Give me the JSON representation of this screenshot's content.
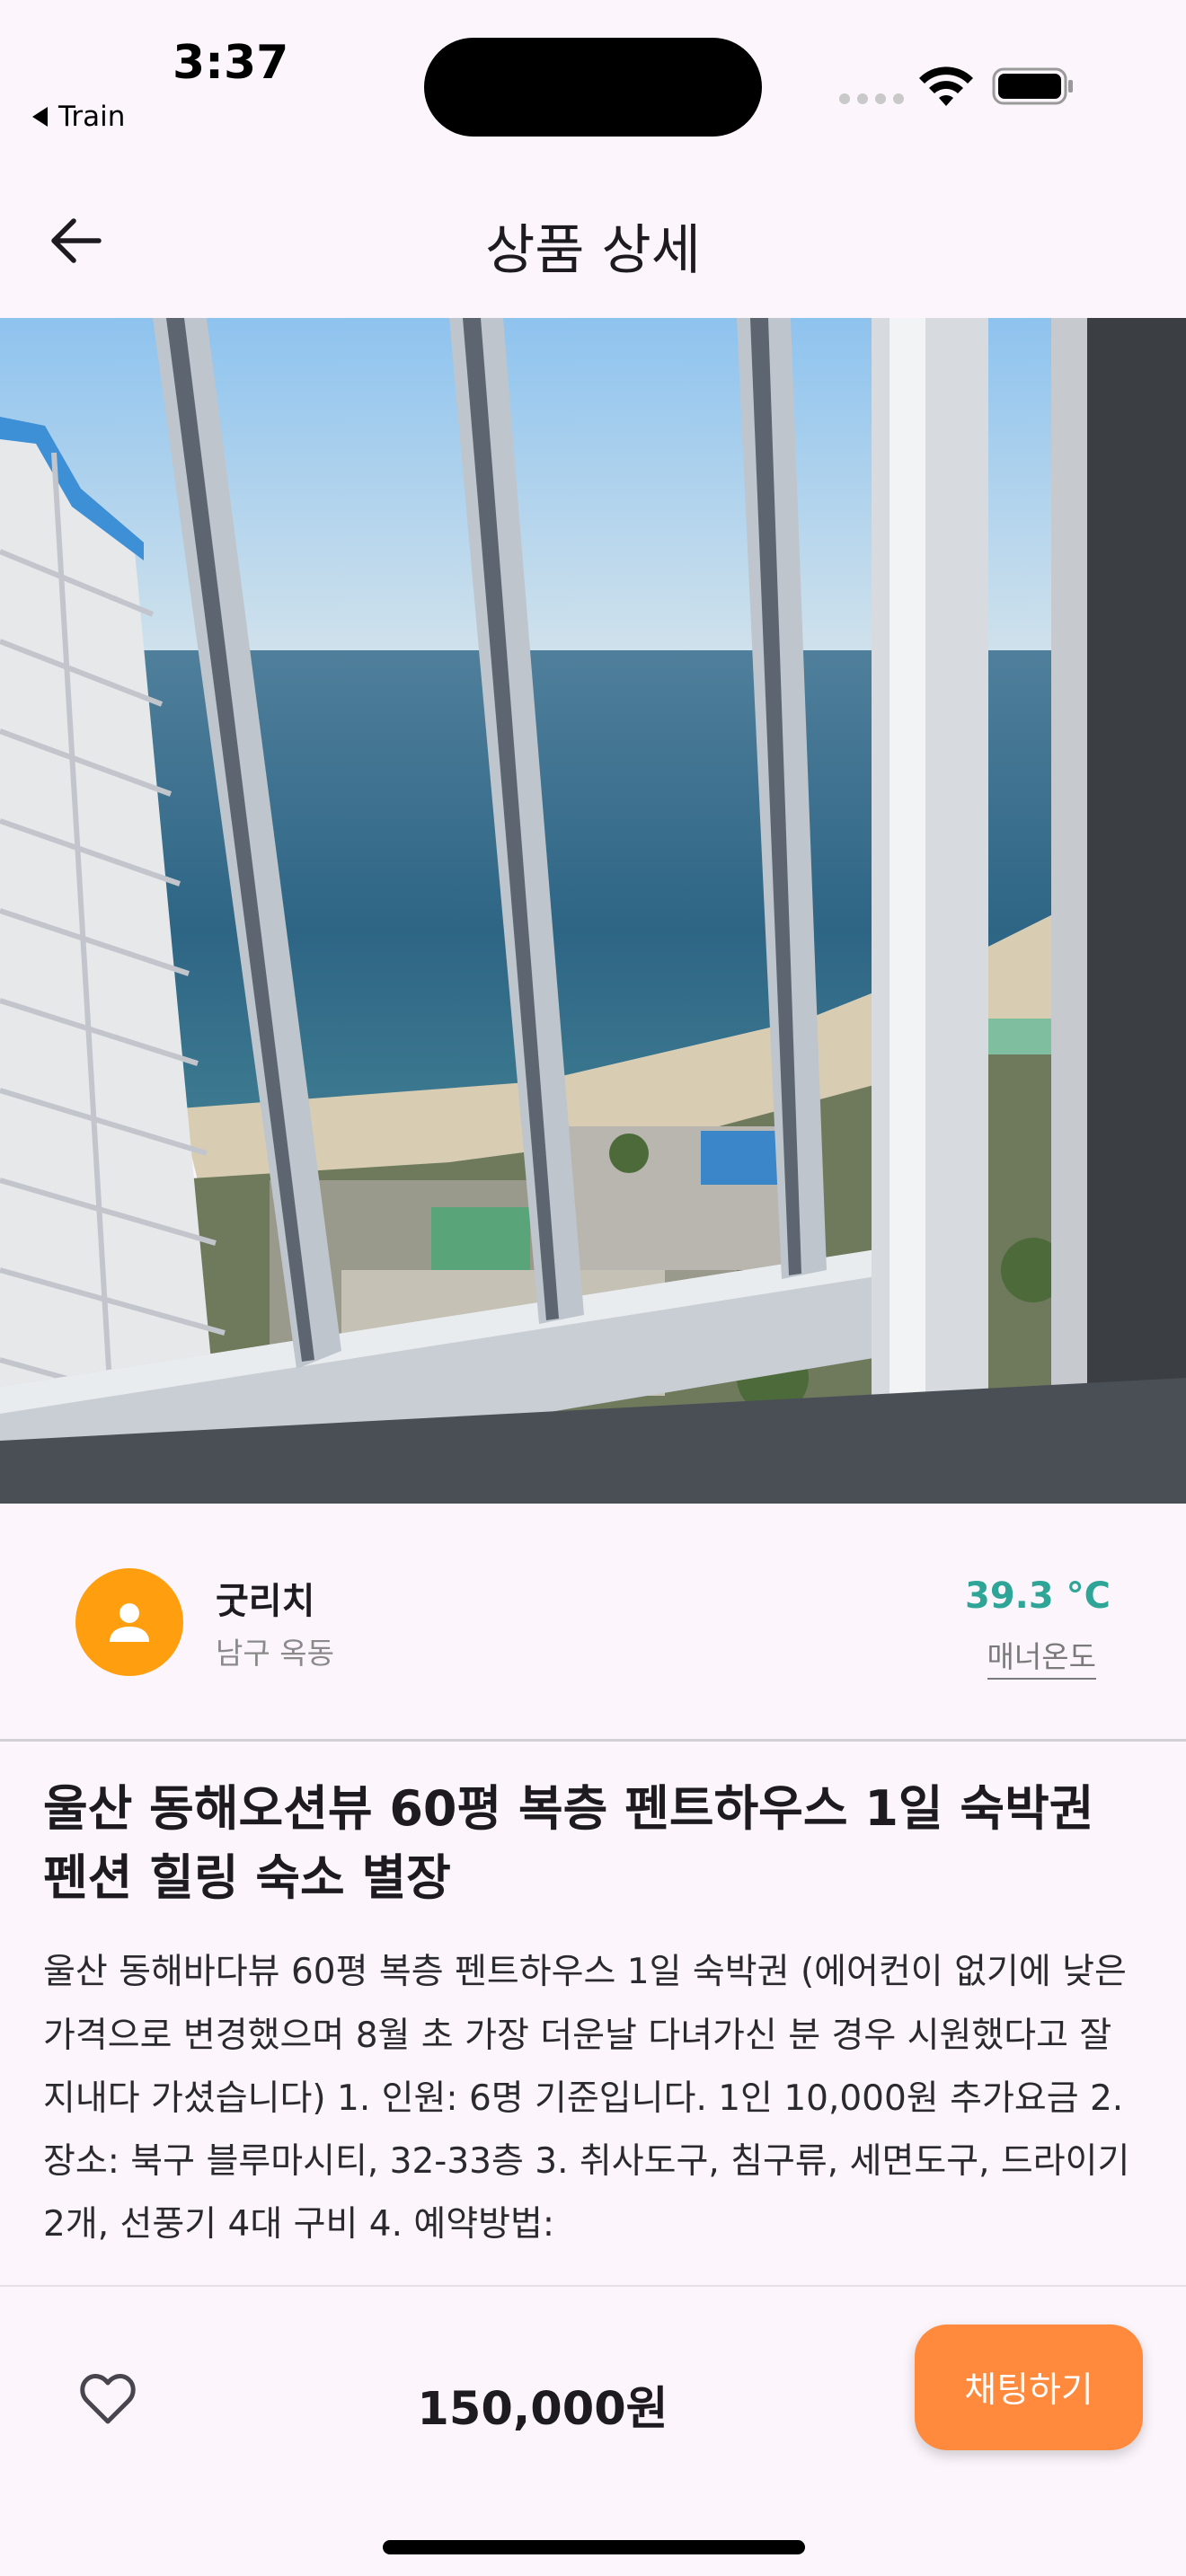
{
  "status_bar": {
    "time": "3:37",
    "back_app": "Train"
  },
  "app_bar": {
    "title": "상품 상세"
  },
  "photo": {
    "description_icon": "photo"
  },
  "seller": {
    "name": "굿리치",
    "location": "남구 옥동",
    "temperature": "39.3 °C",
    "temperature_label": "매너온도"
  },
  "product": {
    "title": "울산 동해오션뷰 60평 복층 펜트하우스 1일 숙박권 펜션 힐링 숙소 별장",
    "description": "울산 동해바다뷰 60평 복층 펜트하우스 1일 숙박권 (에어컨이 없기에 낮은 가격으로 변경했으며 8월 초 가장 더운날 다녀가신 분 경우 시원했다고 잘 지내다 가셨습니다) 1. 인원: 6명 기준입니다. 1인 10,000원 추가요금 2. 장소: 북구 블루마시티, 32-33층 3. 취사도구, 침구류, 세면도구, 드라이기 2개, 선풍기 4대 구비 4. 예약방법:"
  },
  "bottom_bar": {
    "price": "150,000원",
    "chat_button": "채팅하기"
  },
  "colors": {
    "accent": "#ff8a3d",
    "avatar": "#ff9f0f",
    "temperature": "#2ea596",
    "background": "#fcf6fc"
  }
}
